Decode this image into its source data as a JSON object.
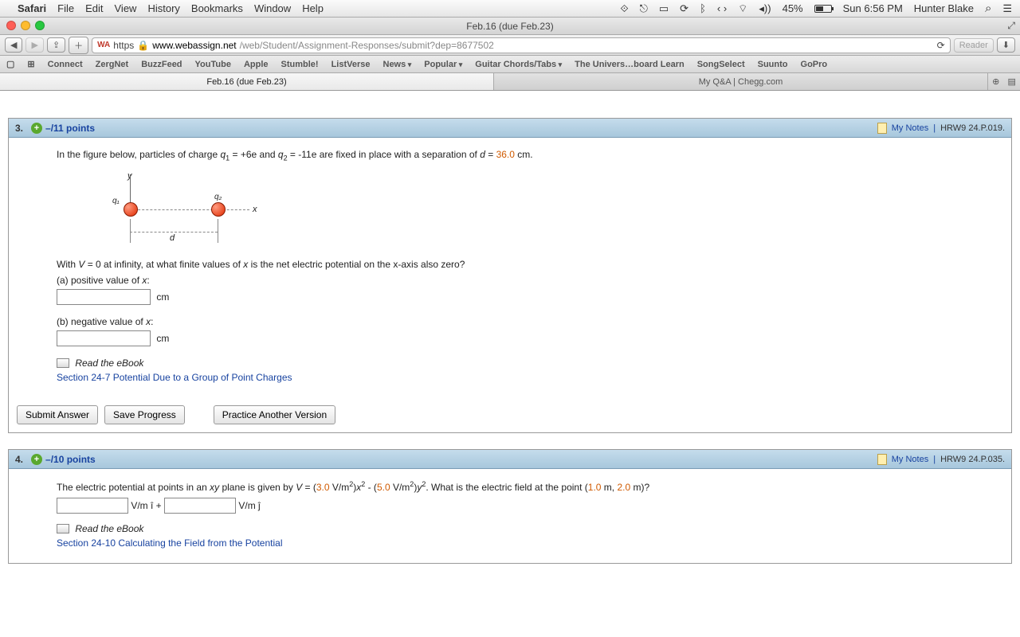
{
  "menubar": {
    "app": "Safari",
    "items": [
      "File",
      "Edit",
      "View",
      "History",
      "Bookmarks",
      "Window",
      "Help"
    ],
    "battery": "45%",
    "clock": "Sun 6:56 PM",
    "user": "Hunter Blake"
  },
  "window": {
    "title": "Feb.16 (due Feb.23)"
  },
  "toolbar": {
    "scheme": "https",
    "host": "www.webassign.net",
    "path": "/web/Student/Assignment-Responses/submit?dep=8677502",
    "reader": "Reader"
  },
  "bookmarks": [
    "Connect",
    "ZergNet",
    "BuzzFeed",
    "YouTube",
    "Apple",
    "Stumble!",
    "ListVerse",
    "News",
    "Popular",
    "Guitar Chords/Tabs",
    "The Univers…board Learn",
    "SongSelect",
    "Suunto",
    "GoPro"
  ],
  "bookmarks_dd": [
    7,
    8,
    9
  ],
  "tabs": [
    {
      "label": "Feb.16 (due Feb.23)",
      "active": true
    },
    {
      "label": "My Q&A | Chegg.com",
      "active": false
    }
  ],
  "q3": {
    "num": "3.",
    "points": "–/11 points",
    "notes": "My Notes",
    "source": "HRW9 24.P.019.",
    "text1": "In the figure below, particles of charge ",
    "q1": "q",
    "q1sub": "1",
    "q1eq": " = +6e",
    "and": " and ",
    "q2": "q",
    "q2sub": "2",
    "q2eq": " = -11e",
    "text2": " are fixed in place with a separation of ",
    "d": "d",
    "d_eq": " = ",
    "d_val": "36.0",
    "d_unit": " cm.",
    "ylab": "y",
    "xlab": "x",
    "q1l": "q₁",
    "q2l": "q₂",
    "dlab": "d",
    "line2a": "With ",
    "V": "V",
    "line2b": " = 0 at infinity, at what finite values of ",
    "x": "x",
    "line2c": " is the net electric potential on the x-axis also zero?",
    "partA": "(a) positive value of ",
    "partA_x": "x",
    "partA_colon": ":",
    "unitA": "cm",
    "partB": "(b) negative value of ",
    "partB_x": "x",
    "partB_colon": ":",
    "unitB": "cm",
    "eb": "Read the eBook",
    "sec": "Section 24-7 Potential Due to a Group of Point Charges",
    "btn_submit": "Submit Answer",
    "btn_save": "Save Progress",
    "btn_practice": "Practice Another Version"
  },
  "q4": {
    "num": "4.",
    "points": "–/10 points",
    "notes": "My Notes",
    "source": "HRW9 24.P.035.",
    "t1": "The electric potential at points in an ",
    "xy": "xy",
    "t2": " plane is given by ",
    "V": "V",
    "eq": " = (",
    "c1": "3.0",
    "u1": " V/m",
    "sq": "2",
    "rp1": ")",
    "x": "x",
    "sq2": "2",
    "minus": " - (",
    "c2": "5.0",
    "u2": " V/m",
    "sq3": "2",
    "rp2": ")",
    "y": "y",
    "sq4": "2",
    "t3": ". What is the electric field at the point (",
    "p1": "1.0",
    "pm": " m, ",
    "p2": "2.0",
    "t4": " m)?",
    "ui": "V/m î + ",
    "uj": "V/m ĵ",
    "eb": "Read the eBook",
    "sec": "Section 24-10 Calculating the Field from the Potential"
  }
}
